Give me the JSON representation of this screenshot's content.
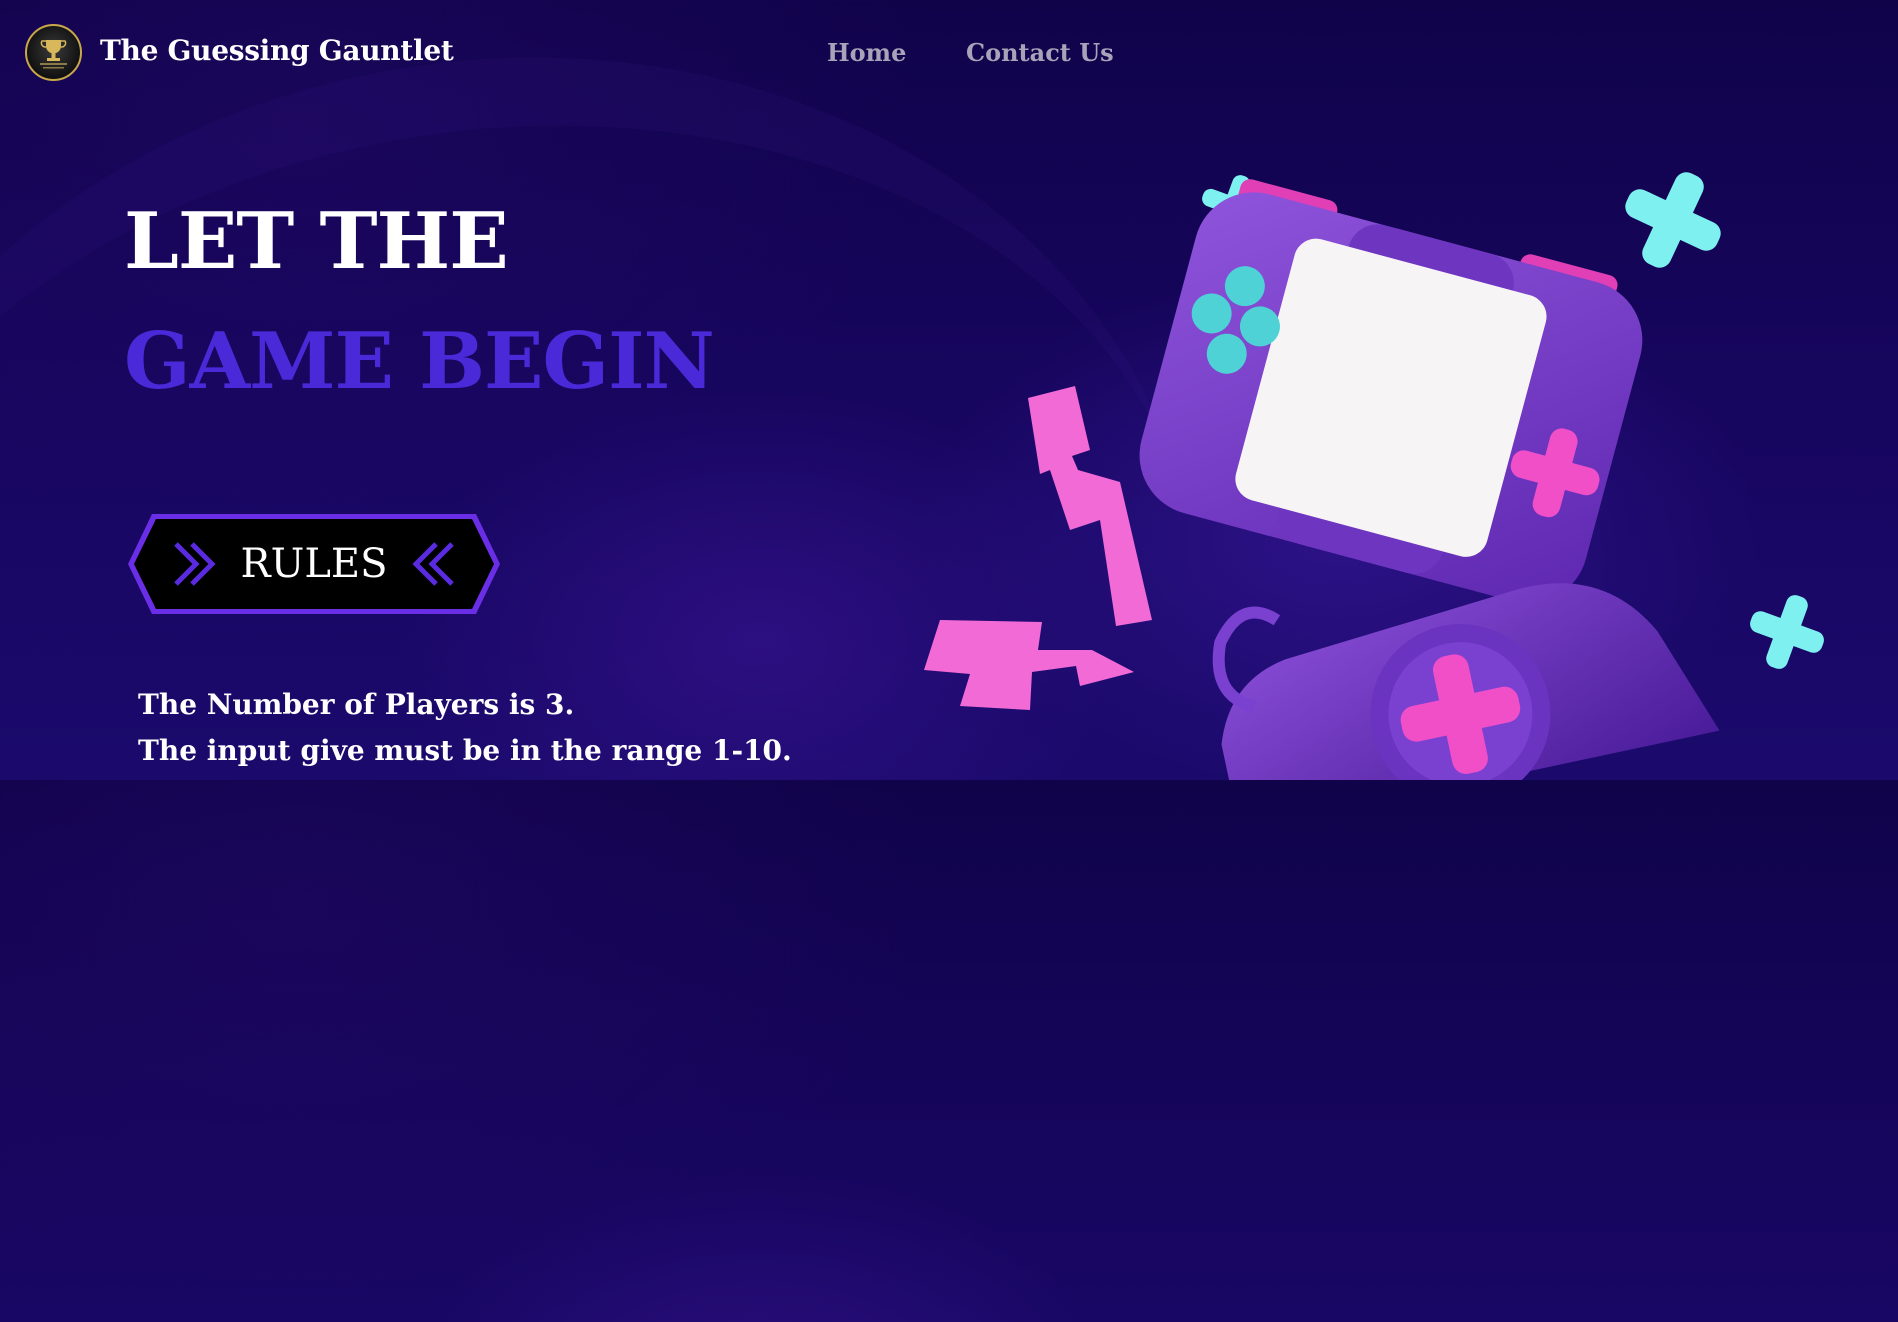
{
  "nav": {
    "brand": "The Guessing Gauntlet",
    "links": [
      {
        "label": "Home"
      },
      {
        "label": "Contact Us"
      }
    ]
  },
  "hero": {
    "line1": "LET THE",
    "line2": "GAME BEGIN",
    "rules_button": "RULES",
    "rules": [
      "The Number of Players is 3.",
      "The input give must be in the range 1-10."
    ]
  },
  "colors": {
    "background": "#150558",
    "accent": "#4a2ad8",
    "nav_link": "#a8a3b8",
    "console_purple": "#7b3fc8",
    "pink": "#f04fc8",
    "cyan": "#7ef0f0"
  },
  "icons": {
    "logo": "trophy-logo-icon",
    "rules_left": "double-chevron-right-icon",
    "rules_right": "double-chevron-left-icon"
  }
}
